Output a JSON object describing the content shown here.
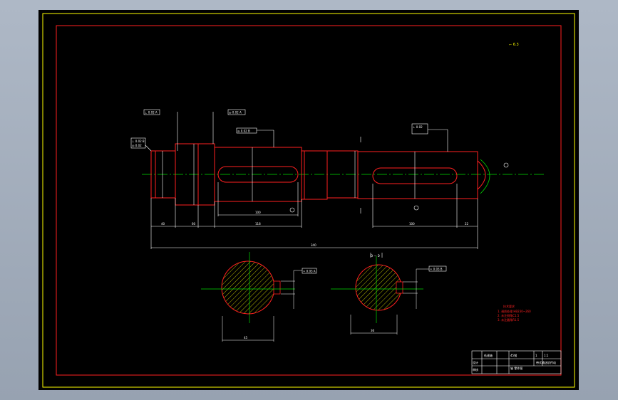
{
  "drawing": {
    "colors": {
      "background": "#000000",
      "frame": "#ffff00",
      "border": "#ff2020",
      "centerline": "#00dd00",
      "dimension": "#ffffff",
      "hatch": "#ffff00",
      "notes": "#ff2020"
    },
    "roughness_note": "⌐ 6.3",
    "dims": {
      "d1": "⊥ 0.02 A",
      "d2": "◎ 0.02 A",
      "d3": "◎ 0.02 B",
      "d4": "⊥ 0.02",
      "d5": "⊥ 0.02 B",
      "d6": "◎ 0.02",
      "overall": "340",
      "l1": "40",
      "l2": "60",
      "l3": "118",
      "l4": "100",
      "l5": "22",
      "section_left": "45",
      "section_right": "36",
      "key_left": "= 0.03 A",
      "key_right": "= 0.03 B",
      "section_label": "D — D"
    },
    "notes_title": "技术要求",
    "notes": [
      "1. 调质处理 HB230~260",
      "2. 未注倒角C1.5",
      "3. 未注圆角R1.5"
    ],
    "title_block": {
      "material": "45钢",
      "part_name": "低速轴",
      "school": "带式输送机传动",
      "drawing_no": "轴 零件图",
      "scale": "1:1",
      "qty": "1",
      "designer": "设计",
      "checker": "审核"
    }
  }
}
